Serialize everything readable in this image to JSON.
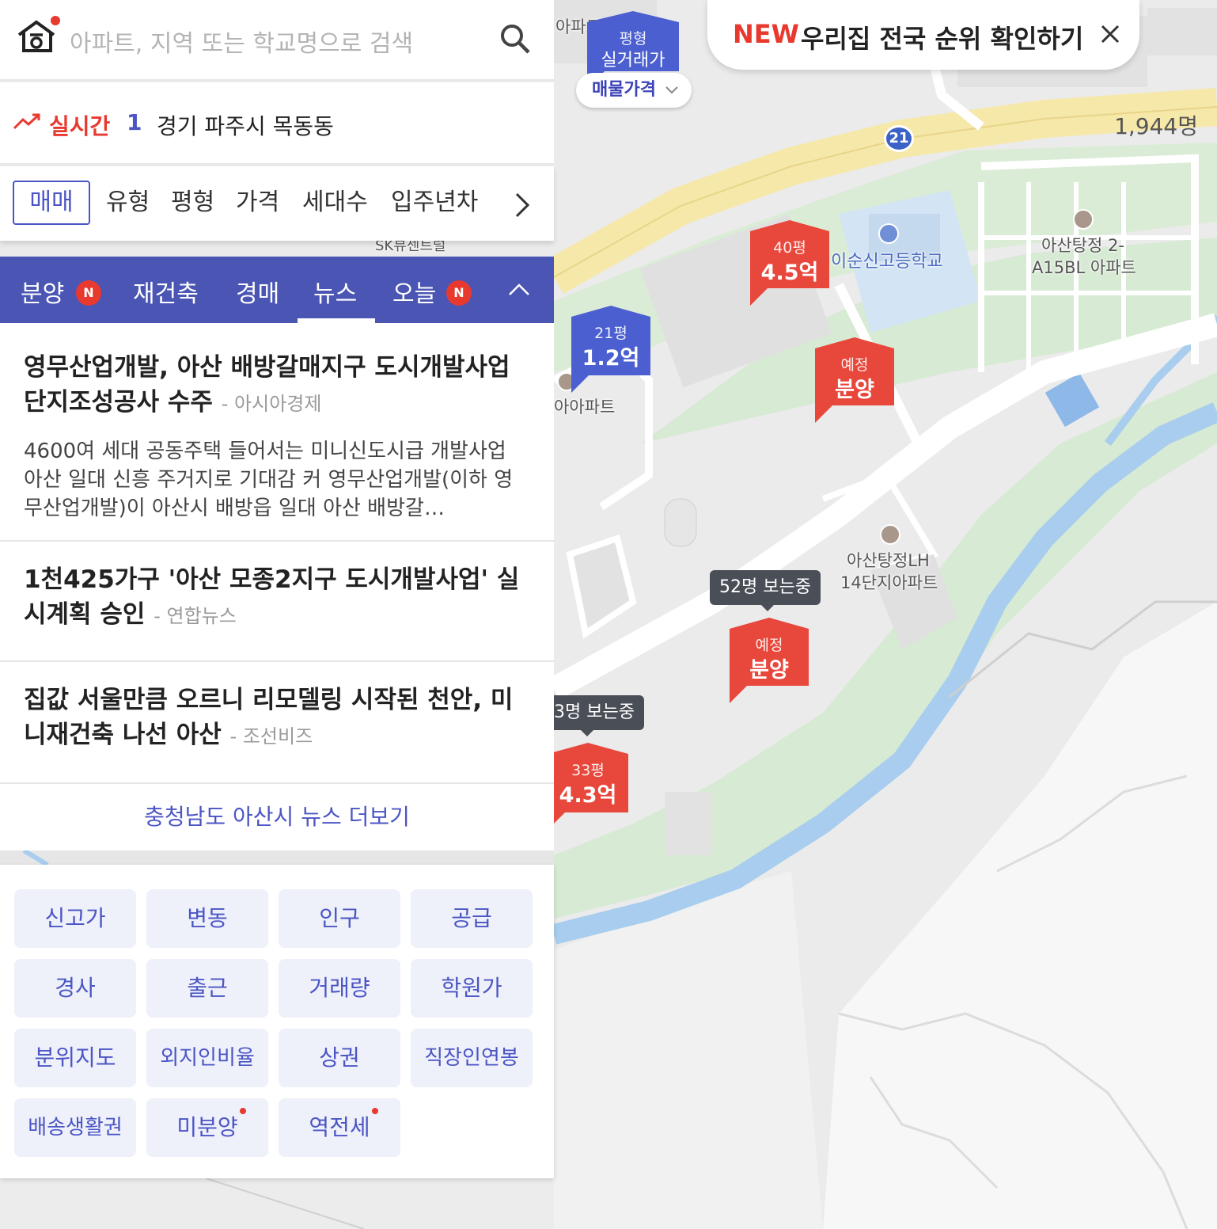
{
  "search": {
    "placeholder": "아파트, 지역 또는 학교명으로 검색"
  },
  "realtime": {
    "label": "실시간",
    "rank": "1",
    "place": "경기 파주시 목동동",
    "count": "1,944명"
  },
  "filters": {
    "active": "매매",
    "items": [
      "유형",
      "평형",
      "가격",
      "세대수",
      "입주년차"
    ]
  },
  "tabs": {
    "items": [
      "분양",
      "재건축",
      "경매",
      "뉴스",
      "오늘"
    ],
    "badge": "N",
    "selected": "뉴스"
  },
  "news": {
    "items": [
      {
        "title": "영무산업개발, 아산 배방갈매지구 도시개발사업 단지조성공사 수주",
        "source": "- 아시아경제",
        "body": "4600여 세대 공동주택 들어서는 미니신도시급 개발사업 아산 일대 신흥 주거지로 기대감 커 영무산업개발(이하 영무산업개발)이 아산시 배방읍 일대 아산 배방갈…"
      },
      {
        "title": "1천425가구 '아산 모종2지구 도시개발사업' 실시계획 승인",
        "source": "- 연합뉴스"
      },
      {
        "title": "집값 서울만큼 오르니 리모델링 시작된 천안, 미니재건축 나선 아산",
        "source": "- 조선비즈"
      }
    ],
    "more": "충청남도 아산시 뉴스 더보기"
  },
  "chips": [
    "신고가",
    "변동",
    "인구",
    "공급",
    "경사",
    "출근",
    "거래량",
    "학원가",
    "분위지도",
    "외지인비율",
    "상권",
    "직장인연봉",
    "배송생활권",
    "미분양",
    "역전세"
  ],
  "banner": {
    "new": "NEW",
    "text": "우리집 전국 순위 확인하기"
  },
  "map": {
    "price_pill": "매물가격",
    "route": "21",
    "markers": [
      {
        "small": "평형",
        "big": "실거래가",
        "color": "#4b5fd0"
      },
      {
        "small": "40평",
        "big": "4.5억",
        "color": "#e8473c"
      },
      {
        "small": "21평",
        "big": "1.2억",
        "color": "#4b5fd0"
      },
      {
        "small": "예정",
        "big": "분양",
        "color": "#e8473c"
      },
      {
        "small": "예정",
        "big": "분양",
        "color": "#e8473c"
      },
      {
        "small": "33평",
        "big": "4.3억",
        "color": "#e8473c"
      }
    ],
    "labels": [
      "이순신고등학교",
      "아산탕정 2-",
      "A15BL 아파트",
      "아산탕정LH",
      "14단지아파트",
      "아아파트",
      "아파트",
      "SK뷰센트럴"
    ],
    "viewers": [
      "52명 보는중",
      "3명 보는중"
    ]
  },
  "colors": {
    "accent": "#4b55c4",
    "tab_bg": "#4b55b4",
    "red": "#e8392f"
  }
}
